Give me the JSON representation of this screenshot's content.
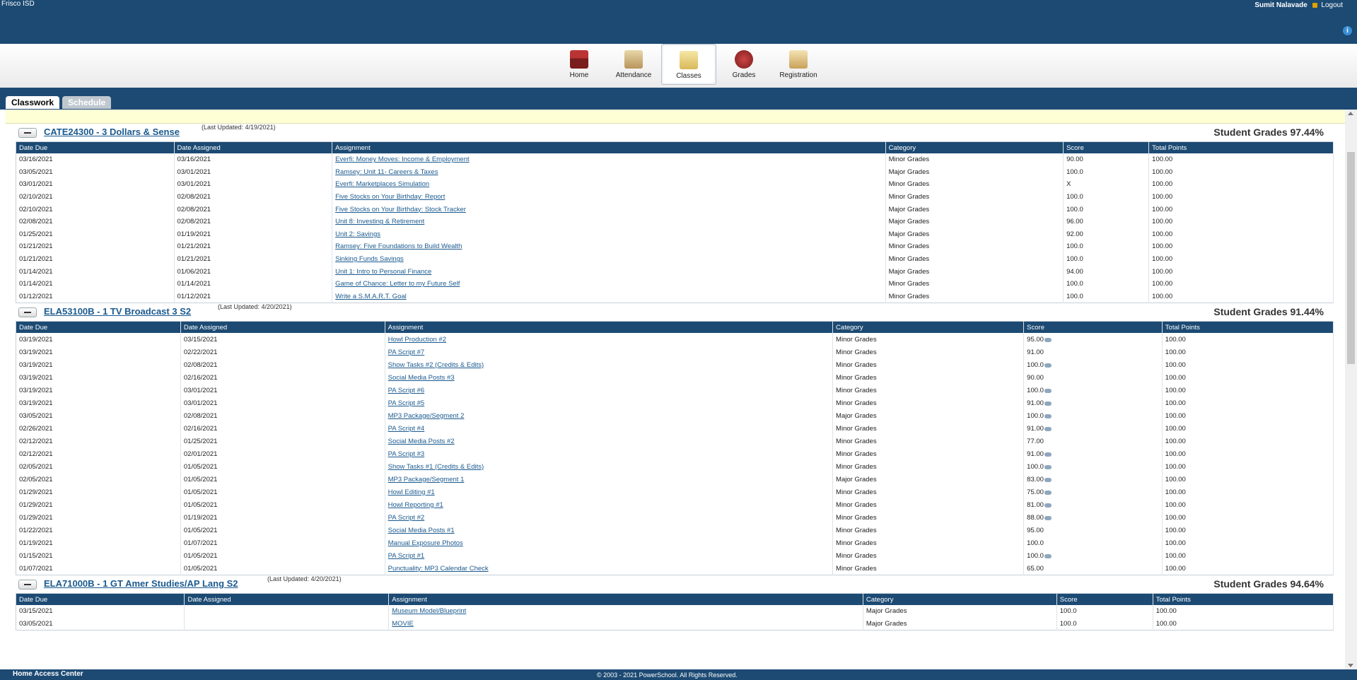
{
  "header": {
    "district": "Frisco ISD",
    "user": "Sumit Nalavade",
    "logout": "Logout",
    "info": "i"
  },
  "nav": [
    {
      "label": "Home"
    },
    {
      "label": "Attendance"
    },
    {
      "label": "Classes"
    },
    {
      "label": "Grades"
    },
    {
      "label": "Registration"
    }
  ],
  "tabs": {
    "classwork": "Classwork",
    "schedule": "Schedule"
  },
  "columns": [
    "Date Due",
    "Date Assigned",
    "Assignment",
    "Category",
    "Score",
    "Total Points"
  ],
  "classes": [
    {
      "name": "CATE24300 - 3 Dollars & Sense",
      "updated": "(Last Updated: 4/19/2021)",
      "grade": "Student Grades 97.44%",
      "rows": [
        [
          "03/16/2021",
          "03/16/2021",
          "Everfi: Money Moves: Income & Employment",
          "Minor Grades",
          "90.00",
          "100.00"
        ],
        [
          "03/05/2021",
          "03/01/2021",
          "Ramsey: Unit 11- Careers & Taxes",
          "Major Grades",
          "100.0",
          "100.00"
        ],
        [
          "03/01/2021",
          "03/01/2021",
          "Everfi: Marketplaces Simulation",
          "Minor Grades",
          "X",
          "100.00"
        ],
        [
          "02/10/2021",
          "02/08/2021",
          "Five Stocks on Your Birthday: Report",
          "Minor Grades",
          "100.0",
          "100.00"
        ],
        [
          "02/10/2021",
          "02/08/2021",
          "Five Stocks on Your Birthday: Stock Tracker",
          "Major Grades",
          "100.0",
          "100.00"
        ],
        [
          "02/08/2021",
          "02/08/2021",
          "Unit 8: Investing & Retirement",
          "Major Grades",
          "96.00",
          "100.00"
        ],
        [
          "01/25/2021",
          "01/19/2021",
          "Unit 2: Savings",
          "Major Grades",
          "92.00",
          "100.00"
        ],
        [
          "01/21/2021",
          "01/21/2021",
          "Ramsey: Five Foundations to Build Wealth",
          "Minor Grades",
          "100.0",
          "100.00"
        ],
        [
          "01/21/2021",
          "01/21/2021",
          "Sinking Funds Savings",
          "Minor Grades",
          "100.0",
          "100.00"
        ],
        [
          "01/14/2021",
          "01/06/2021",
          "Unit 1: Intro to Personal Finance",
          "Major Grades",
          "94.00",
          "100.00"
        ],
        [
          "01/14/2021",
          "01/14/2021",
          "Game of Chance: Letter to my Future Self",
          "Minor Grades",
          "100.0",
          "100.00"
        ],
        [
          "01/12/2021",
          "01/12/2021",
          "Write a S.M.A.R.T. Goal",
          "Minor Grades",
          "100.0",
          "100.00"
        ]
      ]
    },
    {
      "name": "ELA53100B - 1 TV Broadcast 3 S2",
      "updated": "(Last Updated: 4/20/2021)",
      "grade": "Student Grades 91.44%",
      "rows": [
        [
          "03/19/2021",
          "03/15/2021",
          "Howl Production #2",
          "Minor Grades",
          "95.00",
          "100.00",
          true
        ],
        [
          "03/19/2021",
          "02/22/2021",
          "PA Script #7",
          "Minor Grades",
          "91.00",
          "100.00",
          false
        ],
        [
          "03/19/2021",
          "02/08/2021",
          "Show Tasks #2 (Credits & Edits)",
          "Minor Grades",
          "100.0",
          "100.00",
          true
        ],
        [
          "03/19/2021",
          "02/16/2021",
          "Social Media Posts #3",
          "Minor Grades",
          "90.00",
          "100.00",
          false
        ],
        [
          "03/19/2021",
          "03/01/2021",
          "PA Script #6",
          "Minor Grades",
          "100.0",
          "100.00",
          true
        ],
        [
          "03/19/2021",
          "03/01/2021",
          "PA Script #5",
          "Minor Grades",
          "91.00",
          "100.00",
          true
        ],
        [
          "03/05/2021",
          "02/08/2021",
          "MP3 Package/Segment 2",
          "Major Grades",
          "100.0",
          "100.00",
          true
        ],
        [
          "02/26/2021",
          "02/16/2021",
          "PA Script #4",
          "Minor Grades",
          "91.00",
          "100.00",
          true
        ],
        [
          "02/12/2021",
          "01/25/2021",
          "Social Media Posts #2",
          "Minor Grades",
          "77.00",
          "100.00",
          false
        ],
        [
          "02/12/2021",
          "02/01/2021",
          "PA Script #3",
          "Minor Grades",
          "91.00",
          "100.00",
          true
        ],
        [
          "02/05/2021",
          "01/05/2021",
          "Show Tasks #1 (Credits & Edits)",
          "Minor Grades",
          "100.0",
          "100.00",
          true
        ],
        [
          "02/05/2021",
          "01/05/2021",
          "MP3 Package/Segment 1",
          "Major Grades",
          "83.00",
          "100.00",
          true
        ],
        [
          "01/29/2021",
          "01/05/2021",
          "Howl Editing #1",
          "Minor Grades",
          "75.00",
          "100.00",
          true
        ],
        [
          "01/29/2021",
          "01/05/2021",
          "Howl Reporting #1",
          "Minor Grades",
          "81.00",
          "100.00",
          true
        ],
        [
          "01/29/2021",
          "01/19/2021",
          "PA Script #2",
          "Minor Grades",
          "88.00",
          "100.00",
          true
        ],
        [
          "01/22/2021",
          "01/05/2021",
          "Social Media Posts #1",
          "Minor Grades",
          "95.00",
          "100.00",
          false
        ],
        [
          "01/19/2021",
          "01/07/2021",
          "Manual Exposure Photos",
          "Minor Grades",
          "100.0",
          "100.00",
          false
        ],
        [
          "01/15/2021",
          "01/05/2021",
          "PA Script #1",
          "Minor Grades",
          "100.0",
          "100.00",
          true
        ],
        [
          "01/07/2021",
          "01/05/2021",
          "Punctuality: MP3 Calendar Check",
          "Minor Grades",
          "65.00",
          "100.00",
          false
        ]
      ]
    },
    {
      "name": "ELA71000B - 1 GT Amer Studies/AP Lang S2",
      "updated": "(Last Updated: 4/20/2021)",
      "grade": "Student Grades 94.64%",
      "rows": [
        [
          "03/15/2021",
          "",
          "Museum Model/Blueprint",
          "Major Grades",
          "100.0",
          "100.00"
        ],
        [
          "03/05/2021",
          "",
          "MOVIE",
          "Major Grades",
          "100.0",
          "100.00"
        ]
      ]
    }
  ],
  "footer": {
    "app": "Home Access Center",
    "copyright": "© 2003 - 2021 PowerSchool. All Rights Reserved."
  },
  "colors": {
    "header": "#1c4a73",
    "link": "#1b5a8f",
    "highlight": "#ffffd6"
  }
}
